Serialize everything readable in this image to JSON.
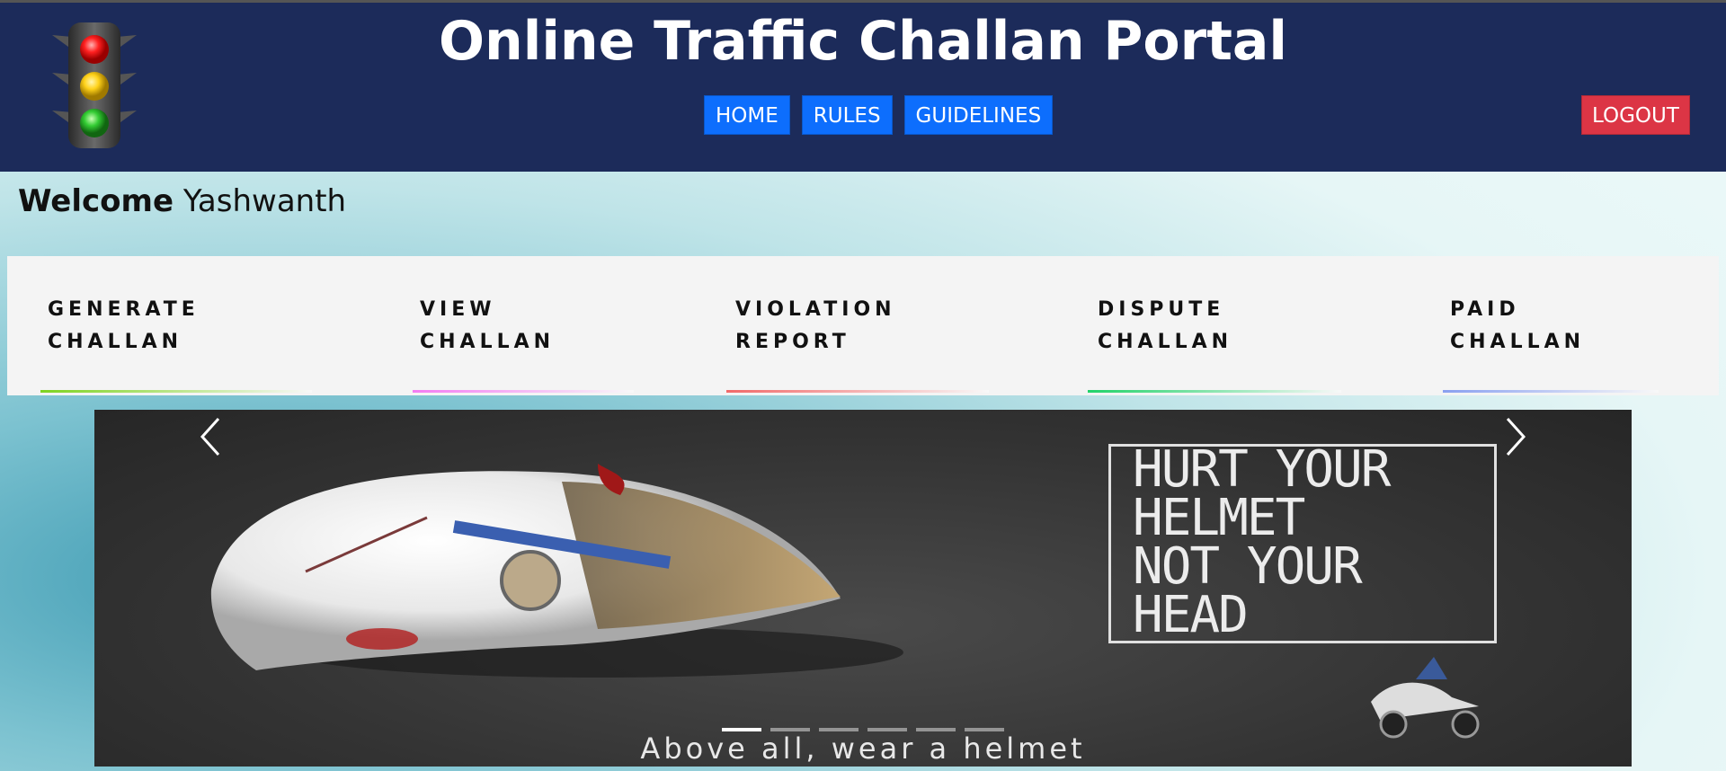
{
  "header": {
    "title": "Online Traffic Challan Portal",
    "nav": [
      "HOME",
      "RULES",
      "GUIDELINES"
    ],
    "logout": "LOGOUT",
    "colors": {
      "background": "#1c2b5a",
      "nav_button": "#0d6efd",
      "logout_button": "#dc3545"
    },
    "logo_icon": "traffic-light-icon"
  },
  "welcome": {
    "label": "Welcome",
    "user": "Yashwanth"
  },
  "menu": [
    {
      "label": "GENERATE\nCHALLAN",
      "underline_color": "#7ed321"
    },
    {
      "label": "VIEW\nCHALLAN",
      "underline_color": "#f27cf2"
    },
    {
      "label": "VIOLATION\nREPORT",
      "underline_color": "#f26a6a"
    },
    {
      "label": "DISPUTE\nCHALLAN",
      "underline_color": "#22d36a"
    },
    {
      "label": "PAID\nCHALLAN",
      "underline_color": "#8aa0f0"
    }
  ],
  "carousel": {
    "sign_text": "HURT YOUR\nHELMET\nNOT YOUR\nHEAD",
    "caption": "Above all, wear a helmet",
    "slide_count": 6,
    "active_slide": 1,
    "prev_icon": "chevron-left-icon",
    "next_icon": "chevron-right-icon"
  }
}
